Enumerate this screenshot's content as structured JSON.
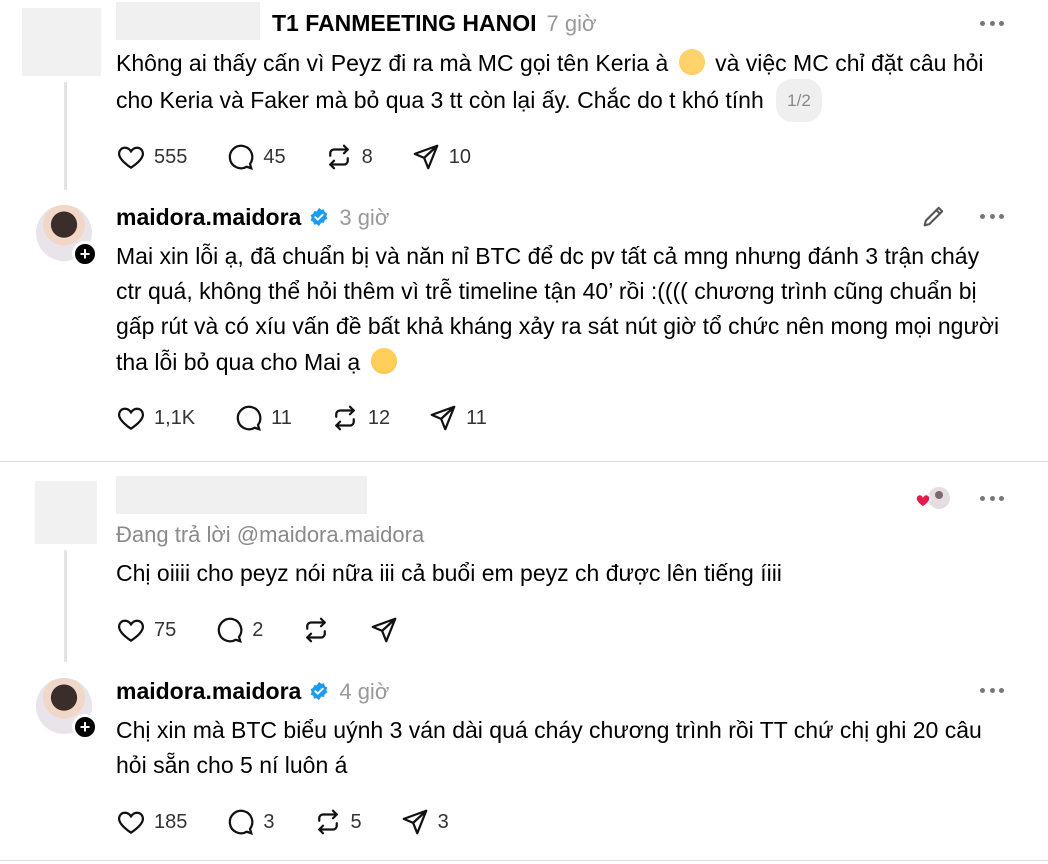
{
  "posts": [
    {
      "username": "T1 FANMEETING HANOI",
      "time": "7 giờ",
      "text_part1": "Không ai thấy cấn vì Peyz đi ra mà MC gọi tên Keria à",
      "text_part2": " và việc MC chỉ đặt câu hỏi cho Keria và Faker mà bỏ qua 3 tt còn lại ấy. Chắc do t khó tính",
      "pager": "1/2",
      "likes": "555",
      "comments": "45",
      "reposts": "8",
      "shares": "10"
    },
    {
      "username": "maidora.maidora",
      "time": "3 giờ",
      "text": "Mai xin lỗi ạ, đã chuẩn bị và năn nỉ BTC để dc pv tất cả mng nhưng đánh 3 trận cháy ctr quá, không thể hỏi thêm vì trễ timeline tận 40’ rồi :(((( chương trình cũng chuẩn bị gấp rút và có xíu vấn đề bất khả kháng xảy ra sát nút giờ tổ chức nên mong mọi người tha lỗi bỏ qua cho Mai ạ",
      "likes": "1,1K",
      "comments": "11",
      "reposts": "12",
      "shares": "11"
    },
    {
      "replying_to": "Đang trả lời @maidora.maidora",
      "text": "Chị oiiii cho peyz nói nữa iii cả buổi em peyz ch được lên tiếng íiii",
      "likes": "75",
      "comments": "2"
    },
    {
      "username": "maidora.maidora",
      "time": "4 giờ",
      "text": "Chị xin mà BTC biểu uýnh 3 ván dài quá cháy chương trình rồi TT chứ chị ghi 20 câu hỏi sẵn cho 5 ní luôn á",
      "likes": "185",
      "comments": "3",
      "reposts": "5",
      "shares": "3"
    }
  ],
  "colors": {
    "verified": "#1d9bf0",
    "time": "#999999",
    "heart": "#e8194b"
  }
}
